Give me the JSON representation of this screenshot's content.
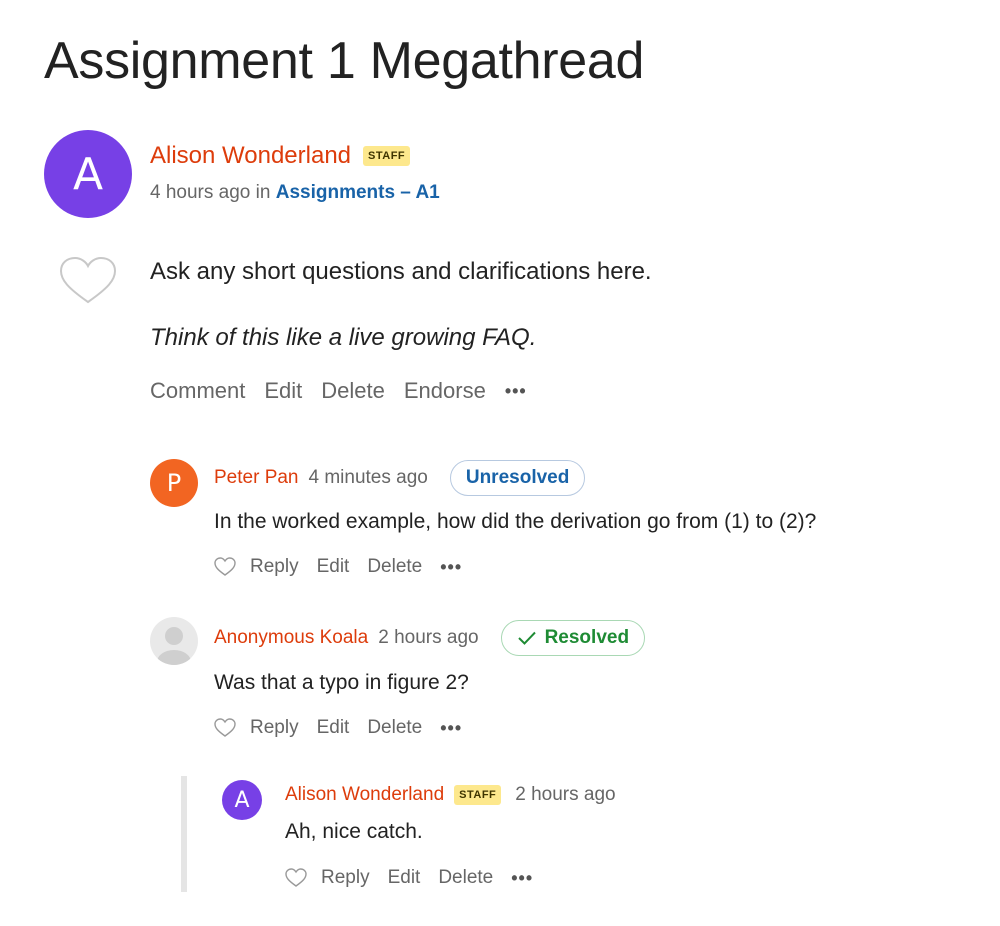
{
  "thread": {
    "title": "Assignment 1 Megathread",
    "author": "Alison Wonderland",
    "avatar_letter": "A",
    "staff_badge": "STAFF",
    "time": "4 hours ago",
    "in_text": "in",
    "category": "Assignments – A1",
    "body_line1": "Ask any short questions and clarifications here.",
    "body_line2": "Think of this like a live growing FAQ.",
    "actions": {
      "comment": "Comment",
      "edit": "Edit",
      "delete": "Delete",
      "endorse": "Endorse",
      "more": "•••"
    }
  },
  "comments": [
    {
      "author": "Peter Pan",
      "avatar_letter": "P",
      "avatar_color": "#f26522",
      "time": "4 minutes ago",
      "status": "Unresolved",
      "text": "In the worked example, how did the derivation go from (1) to (2)?",
      "actions": {
        "reply": "Reply",
        "edit": "Edit",
        "delete": "Delete",
        "more": "•••"
      }
    },
    {
      "author": "Anonymous Koala",
      "avatar_icon": "anonymous-user-icon",
      "time": "2 hours ago",
      "status": "Resolved",
      "text": "Was that a typo in figure 2?",
      "actions": {
        "reply": "Reply",
        "edit": "Edit",
        "delete": "Delete",
        "more": "•••"
      },
      "replies": [
        {
          "author": "Alison Wonderland",
          "avatar_letter": "A",
          "avatar_color": "#7740e6",
          "staff_badge": "STAFF",
          "time": "2 hours ago",
          "text": "Ah, nice catch.",
          "actions": {
            "reply": "Reply",
            "edit": "Edit",
            "delete": "Delete",
            "more": "•••"
          }
        }
      ]
    }
  ],
  "colors": {
    "author_name": "#dd3c0b",
    "category_link": "#1963a8",
    "staff_badge_bg": "#fde88d",
    "resolved": "#1e8b34",
    "unresolved": "#1963a8"
  }
}
